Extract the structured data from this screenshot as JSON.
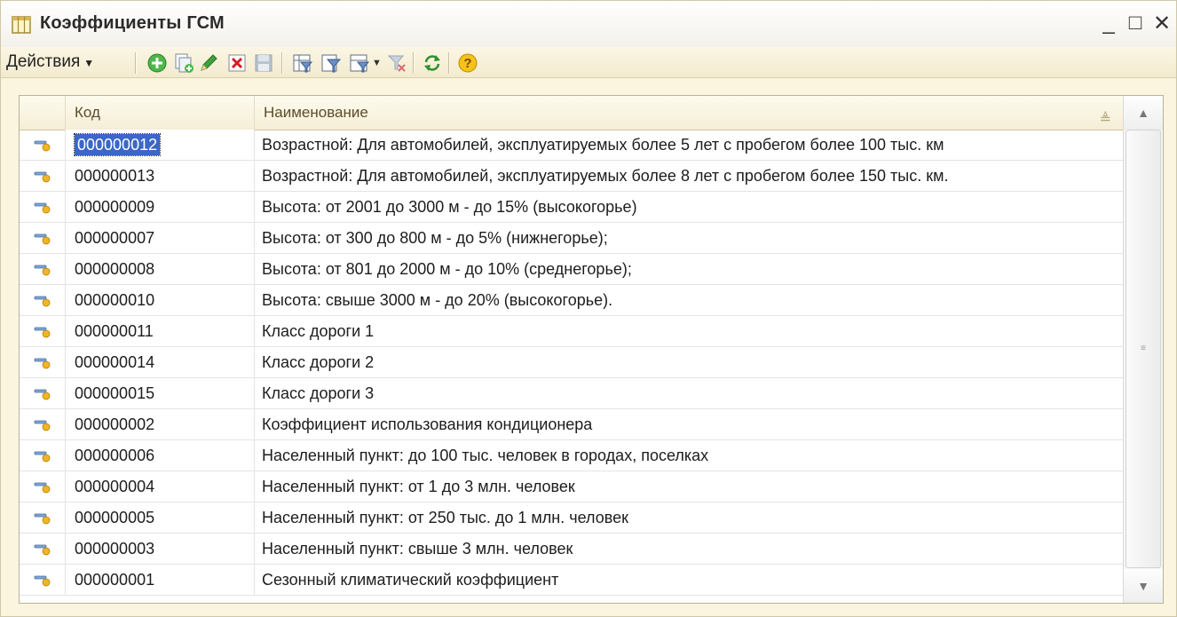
{
  "window": {
    "title": "Коэффициенты ГСМ",
    "minimize": "_",
    "maximize": "□",
    "close": "✕"
  },
  "toolbar": {
    "actions_label": "Действия",
    "icons": [
      "add-icon",
      "copy-icon",
      "edit-icon",
      "delete-icon",
      "save-icon",
      "filter-icon",
      "filter-by-value-icon",
      "filter-history-icon",
      "filter-off-icon",
      "refresh-icon",
      "help-icon"
    ]
  },
  "grid": {
    "columns": {
      "code": "Код",
      "name": "Наименование"
    },
    "rows": [
      {
        "code": "000000012",
        "name": "Возрастной: Для автомобилей, эксплуатируемых более 5 лет с пробегом более 100 тыс. км"
      },
      {
        "code": "000000013",
        "name": "Возрастной: Для автомобилей, эксплуатируемых более 8 лет с пробегом более 150 тыс. км."
      },
      {
        "code": "000000009",
        "name": "Высота: от 2001 до 3000 м - до 15% (высокогорье)"
      },
      {
        "code": "000000007",
        "name": "Высота: от 300 до 800 м - до 5% (нижнегорье);"
      },
      {
        "code": "000000008",
        "name": "Высота: от 801 до 2000 м - до 10% (среднегорье);"
      },
      {
        "code": "000000010",
        "name": "Высота: свыше 3000 м - до 20% (высокогорье)."
      },
      {
        "code": "000000011",
        "name": "Класс дороги 1"
      },
      {
        "code": "000000014",
        "name": "Класс дороги 2"
      },
      {
        "code": "000000015",
        "name": "Класс дороги 3"
      },
      {
        "code": "000000002",
        "name": "Коэффициент использования кондиционера"
      },
      {
        "code": "000000006",
        "name": "Населенный пункт: до 100 тыс. человек в городах, поселках"
      },
      {
        "code": "000000004",
        "name": "Населенный пункт: от 1 до 3 млн. человек"
      },
      {
        "code": "000000005",
        "name": "Населенный пункт: от 250 тыс. до 1 млн. человек"
      },
      {
        "code": "000000003",
        "name": "Населенный пункт: свыше 3 млн. человек"
      },
      {
        "code": "000000001",
        "name": "Сезонный климатический коэффициент"
      }
    ],
    "selected_row": 0
  },
  "colors": {
    "selection": "#3a67c8",
    "window_bg": "#fbf5df"
  }
}
